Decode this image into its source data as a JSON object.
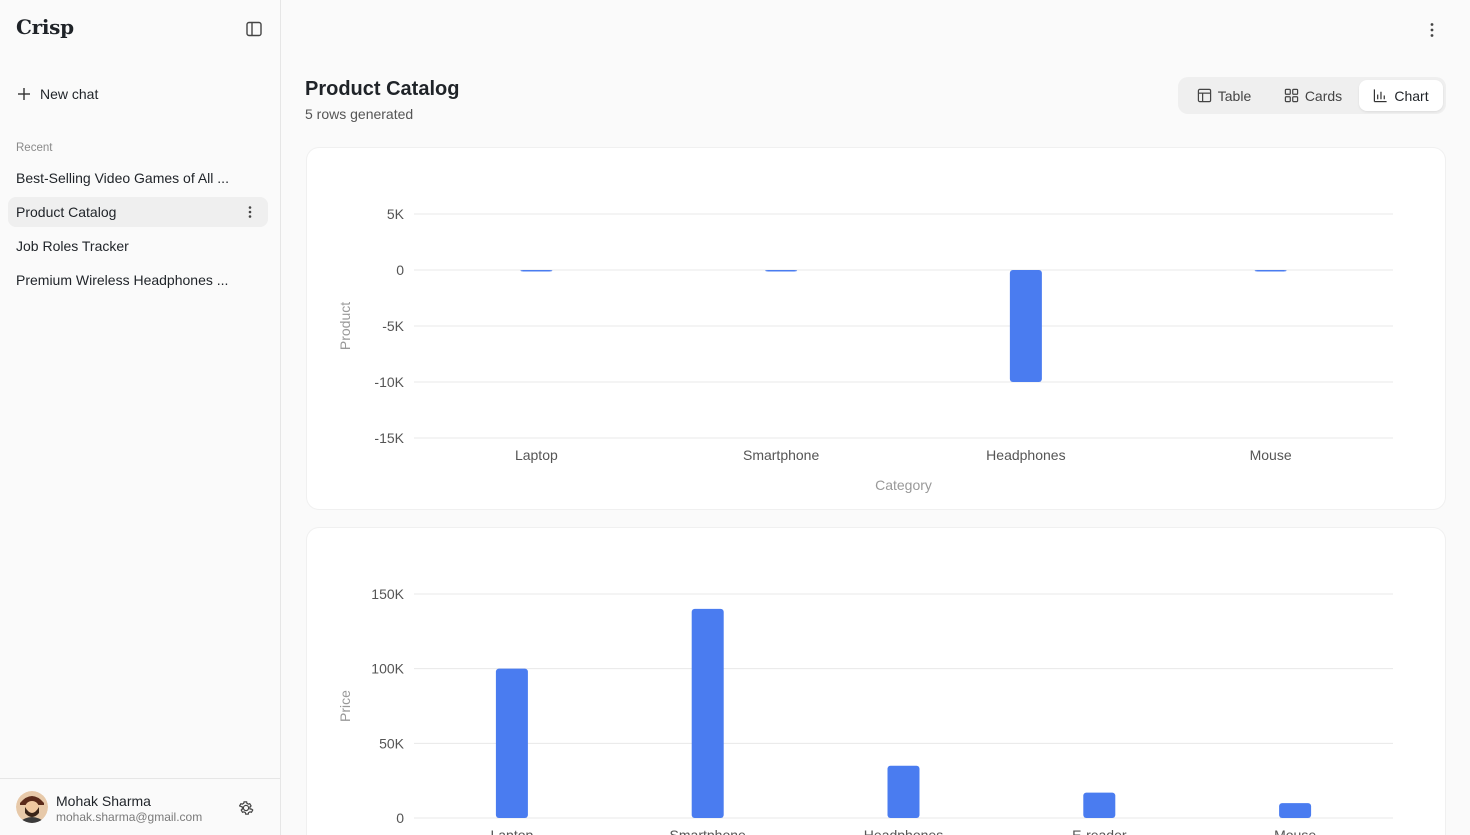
{
  "sidebar": {
    "brand": "Crisp",
    "new_chat_label": "New chat",
    "recent_label": "Recent",
    "recent": [
      {
        "label": "Best-Selling Video Games of All ..."
      },
      {
        "label": "Product Catalog"
      },
      {
        "label": "Job Roles Tracker"
      },
      {
        "label": "Premium Wireless Headphones ..."
      }
    ],
    "user": {
      "name": "Mohak Sharma",
      "email": "mohak.sharma@gmail.com"
    }
  },
  "main": {
    "title": "Product Catalog",
    "subtitle": "5 rows generated",
    "views": [
      {
        "label": "Table",
        "icon": "table-icon"
      },
      {
        "label": "Cards",
        "icon": "grid-icon"
      },
      {
        "label": "Chart",
        "icon": "bar-chart-icon"
      }
    ],
    "active_view": "Chart"
  },
  "colors": {
    "bar": "#4a7cf0",
    "grid": "#e8e8e8",
    "axis_text": "#555555",
    "axis_title": "#999999"
  },
  "chart_data": [
    {
      "type": "bar",
      "categories": [
        "Laptop",
        "Smartphone",
        "Headphones",
        "Mouse"
      ],
      "values": [
        -100,
        -50,
        -10000,
        -100
      ],
      "xlabel": "Category",
      "ylabel": "Product",
      "yticks": [
        "5K",
        "0",
        "-5K",
        "-10K",
        "-15K"
      ],
      "ytick_values": [
        5000,
        0,
        -5000,
        -10000,
        -15000
      ],
      "ylim": [
        -15000,
        5000
      ],
      "grid": true
    },
    {
      "type": "bar",
      "categories": [
        "Laptop",
        "Smartphone",
        "Headphones",
        "E-reader",
        "Mouse"
      ],
      "values": [
        100000,
        140000,
        35000,
        17000,
        10000
      ],
      "xlabel": "",
      "ylabel": "Price",
      "yticks": [
        "150K",
        "100K",
        "50K",
        "0"
      ],
      "ytick_values": [
        150000,
        100000,
        50000,
        0
      ],
      "ylim": [
        0,
        150000
      ],
      "grid": true
    }
  ]
}
